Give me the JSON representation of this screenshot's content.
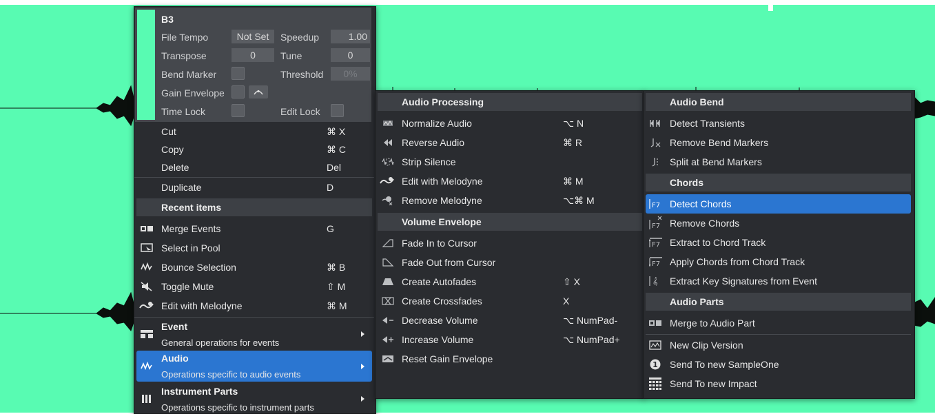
{
  "inspector": {
    "event_name": "B3",
    "file_tempo_label": "File Tempo",
    "file_tempo_value": "Not Set",
    "speedup_label": "Speedup",
    "speedup_value": "1.00",
    "transpose_label": "Transpose",
    "transpose_value": "0",
    "tune_label": "Tune",
    "tune_value": "0",
    "bend_marker_label": "Bend Marker",
    "threshold_label": "Threshold",
    "threshold_value": "0%",
    "gain_envelope_label": "Gain Envelope",
    "time_lock_label": "Time Lock",
    "edit_lock_label": "Edit Lock",
    "swatch_color": "#58fbb2"
  },
  "menu1": {
    "edit_items": [
      {
        "label": "Cut",
        "shortcut": "⌘ X"
      },
      {
        "label": "Copy",
        "shortcut": "⌘ C"
      },
      {
        "label": "Delete",
        "shortcut": "Del"
      },
      {
        "label": "Duplicate",
        "shortcut": "D"
      }
    ],
    "recent_header": "Recent items",
    "recent_items": [
      {
        "label": "Merge Events",
        "shortcut": "G",
        "icon": "merge-events-icon"
      },
      {
        "label": "Select in Pool",
        "shortcut": "",
        "icon": "select-pool-icon"
      },
      {
        "label": "Bounce Selection",
        "shortcut": "⌘ B",
        "icon": "bounce-icon"
      },
      {
        "label": "Toggle Mute",
        "shortcut": "⇧ M",
        "icon": "mute-icon"
      },
      {
        "label": "Edit with Melodyne",
        "shortcut": "⌘ M",
        "icon": "melodyne-icon"
      }
    ],
    "submenus": [
      {
        "title": "Event",
        "desc": "General operations for events",
        "icon": "event-icon"
      },
      {
        "title": "Audio",
        "desc": "Operations specific to audio events",
        "icon": "audio-wave-icon"
      },
      {
        "title": "Instrument Parts",
        "desc": "Operations specific to instrument parts",
        "icon": "instrument-icon"
      }
    ]
  },
  "menu2": {
    "audio_processing_header": "Audio Processing",
    "audio_processing": [
      {
        "label": "Normalize Audio",
        "shortcut": "⌥ N",
        "icon": "normalize-icon"
      },
      {
        "label": "Reverse Audio",
        "shortcut": "⌘ R",
        "icon": "reverse-icon"
      },
      {
        "label": "Strip Silence",
        "shortcut": "",
        "icon": "strip-silence-icon"
      },
      {
        "label": "Edit with Melodyne",
        "shortcut": "⌘ M",
        "icon": "melodyne-icon"
      },
      {
        "label": "Remove Melodyne",
        "shortcut": "⌥⌘ M",
        "icon": "remove-melodyne-icon"
      }
    ],
    "volume_envelope_header": "Volume Envelope",
    "volume_envelope": [
      {
        "label": "Fade In to Cursor",
        "shortcut": "",
        "icon": "fade-in-icon"
      },
      {
        "label": "Fade Out from Cursor",
        "shortcut": "",
        "icon": "fade-out-icon"
      },
      {
        "label": "Create Autofades",
        "shortcut": "⇧ X",
        "icon": "autofade-icon"
      },
      {
        "label": "Create Crossfades",
        "shortcut": "X",
        "icon": "crossfade-icon"
      },
      {
        "label": "Decrease Volume",
        "shortcut": "⌥ NumPad-",
        "icon": "volume-decrease-icon"
      },
      {
        "label": "Increase Volume",
        "shortcut": "⌥ NumPad+",
        "icon": "volume-increase-icon"
      },
      {
        "label": "Reset Gain Envelope",
        "shortcut": "",
        "icon": "reset-gain-icon"
      }
    ]
  },
  "menu3": {
    "audio_bend_header": "Audio Bend",
    "audio_bend": [
      {
        "label": "Detect Transients",
        "icon": "transients-icon"
      },
      {
        "label": "Remove Bend Markers",
        "icon": "remove-bend-icon"
      },
      {
        "label": "Split at Bend Markers",
        "icon": "split-bend-icon"
      }
    ],
    "chords_header": "Chords",
    "chords": [
      {
        "label": "Detect Chords",
        "icon": "detect-chords-icon"
      },
      {
        "label": "Remove Chords",
        "icon": "remove-chords-icon"
      },
      {
        "label": "Extract to Chord Track",
        "icon": "extract-chord-icon"
      },
      {
        "label": "Apply Chords from Chord Track",
        "icon": "apply-chords-icon"
      },
      {
        "label": "Extract Key Signatures from Event",
        "icon": "key-signature-icon"
      }
    ],
    "audio_parts_header": "Audio Parts",
    "audio_parts": [
      {
        "label": "Merge to Audio Part",
        "icon": "merge-audio-part-icon"
      },
      {
        "label": "New Clip Version",
        "icon": "clip-version-icon"
      },
      {
        "label": "Send To new SampleOne",
        "icon": "sampleone-icon"
      },
      {
        "label": "Send To new Impact",
        "icon": "impact-icon"
      }
    ]
  },
  "colors": {
    "background": "#58fbb2",
    "menu": "#2a2c30",
    "selection": "#2b76d1",
    "header": "#3d4045"
  }
}
